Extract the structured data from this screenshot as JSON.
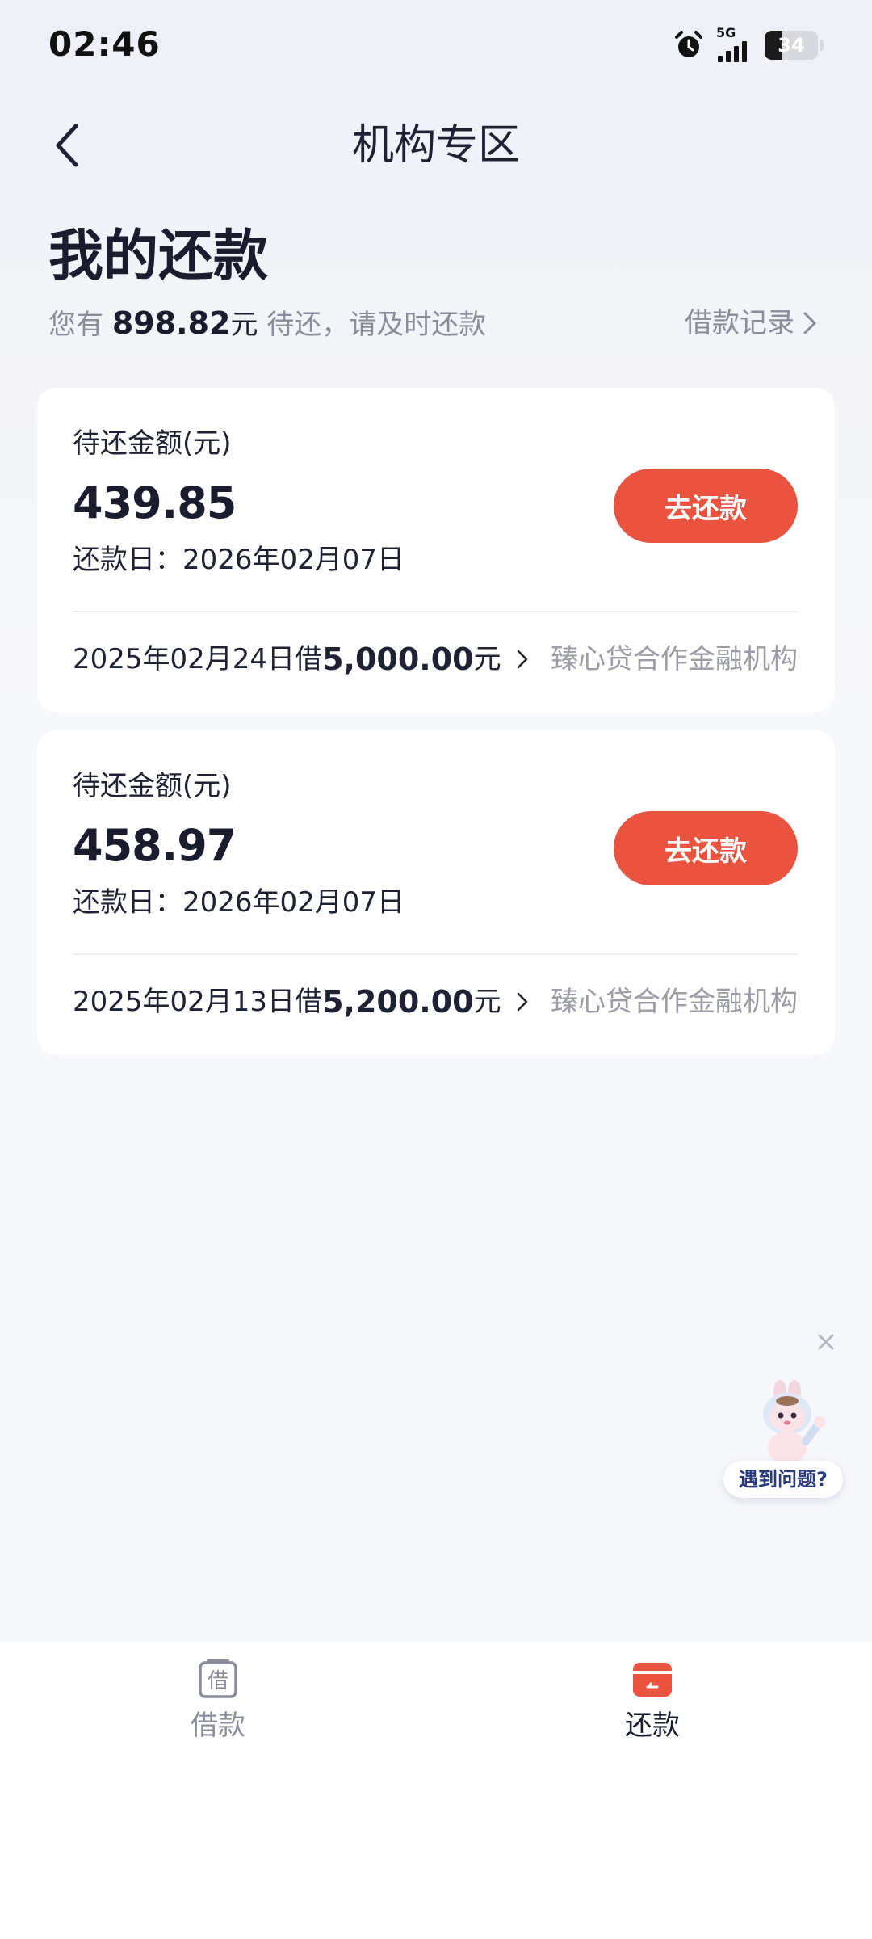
{
  "status_bar": {
    "time": "02:46",
    "network": "5G",
    "battery": "34",
    "battery_level": 0.34
  },
  "nav": {
    "title": "机构专区"
  },
  "header": {
    "title": "我的还款",
    "summary_prefix": "您有",
    "summary_amount": "898.82",
    "summary_unit": "元",
    "summary_suffix": "待还，请及时还款",
    "history_link": "借款记录"
  },
  "loans": [
    {
      "label": "待还金额(元)",
      "amount": "439.85",
      "due_label": "还款日：",
      "due_date": "2026年02月07日",
      "button": "去还款",
      "loan_date": "2025年02月24日借",
      "loan_amount": "5,000.00",
      "loan_unit": "元",
      "institution": "臻心贷合作金融机构"
    },
    {
      "label": "待还金额(元)",
      "amount": "458.97",
      "due_label": "还款日：",
      "due_date": "2026年02月07日",
      "button": "去还款",
      "loan_date": "2025年02月13日借",
      "loan_amount": "5,200.00",
      "loan_unit": "元",
      "institution": "臻心贷合作金融机构"
    }
  ],
  "helper": {
    "label": "遇到问题?"
  },
  "tabs": [
    {
      "label": "借款",
      "icon_glyph": "借",
      "active": false
    },
    {
      "label": "还款",
      "active": true
    }
  ],
  "colors": {
    "accent": "#e9533f",
    "text_primary": "#1a1d2e",
    "text_secondary": "#8a8d99",
    "background": "#f6f7fa"
  }
}
